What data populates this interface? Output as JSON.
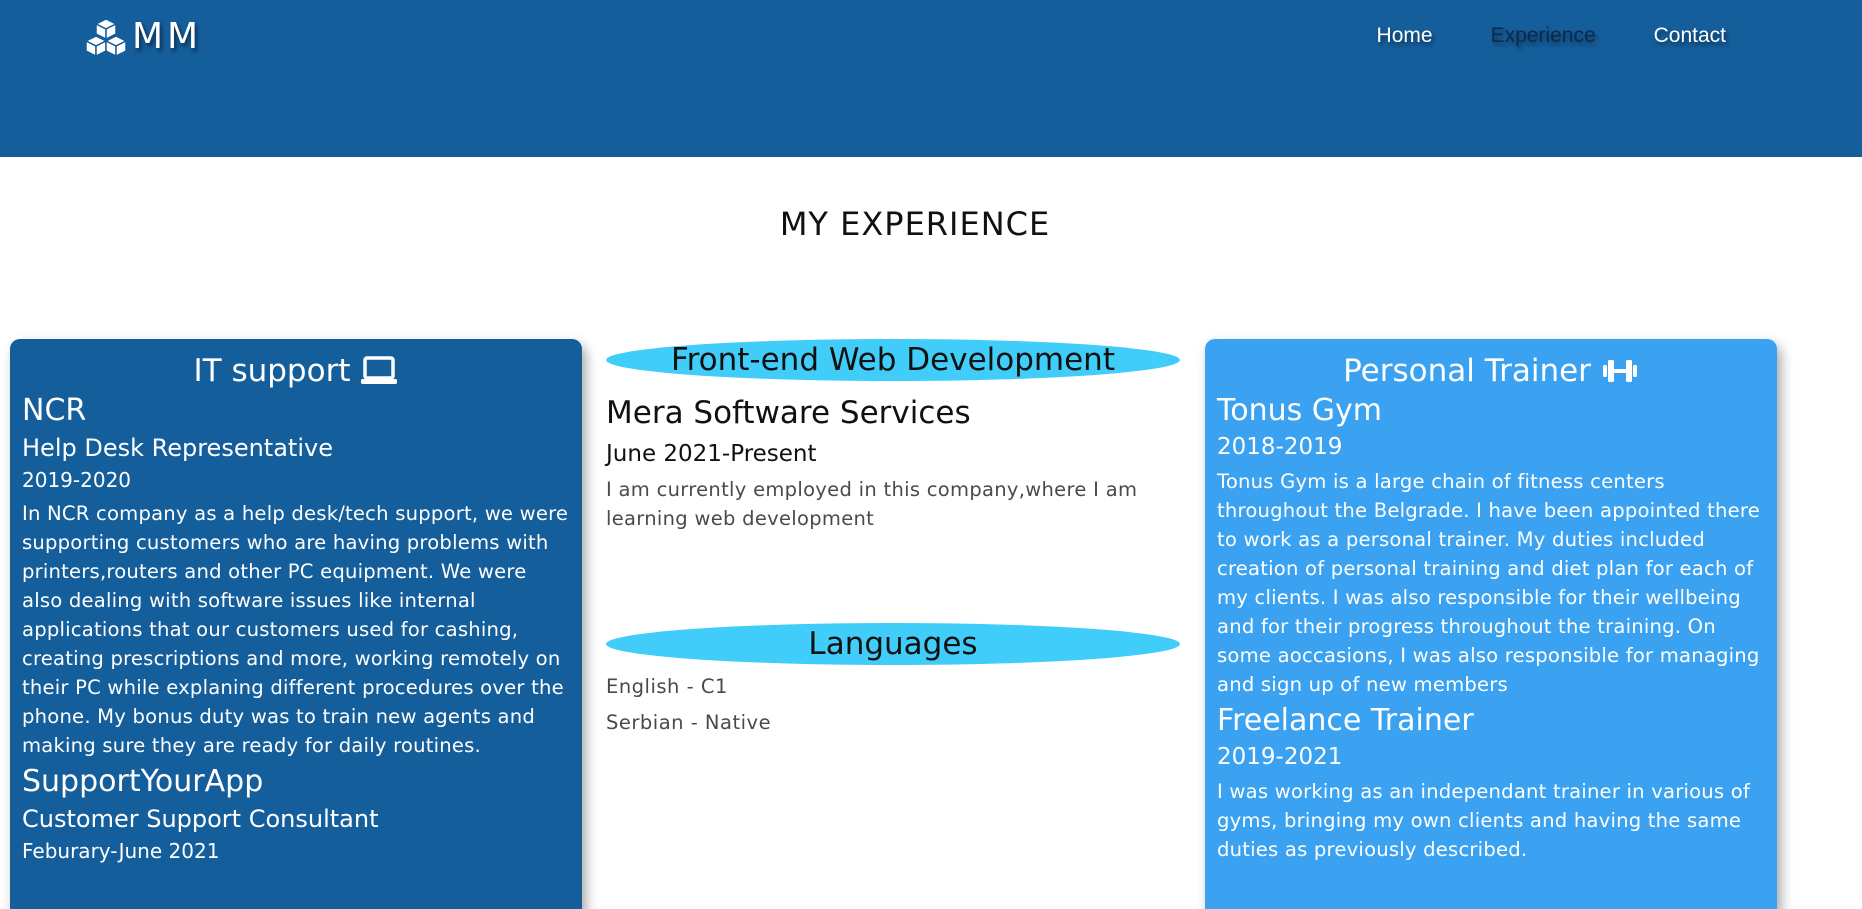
{
  "header": {
    "logo_text": "MM",
    "nav": [
      {
        "label": "Home"
      },
      {
        "label": "Experience"
      },
      {
        "label": "Contact"
      }
    ]
  },
  "page_title": "MY EXPERIENCE",
  "left_card": {
    "title": "IT support",
    "icon": "laptop-icon",
    "jobs": [
      {
        "company": "NCR",
        "role": "Help Desk Representative",
        "period": "2019-2020",
        "description": "In NCR company as a help desk/tech support, we were supporting customers who are having problems with printers,routers and other PC equipment. We were also dealing with software issues like internal applications that our customers used for cashing, creating prescriptions and more, working remotely on their PC while explaning different procedures over the phone. My bonus duty was to train new agents and making sure they are ready for daily routines."
      },
      {
        "company": "SupportYourApp",
        "role": "Customer Support Consultant",
        "period": "Feburary-June 2021"
      }
    ]
  },
  "middle": {
    "web_dev": {
      "title": "Front-end Web Development",
      "company": "Mera Software Services",
      "period": "June 2021-Present",
      "description": "I am currently employed in this company,where I am learning web development"
    },
    "languages": {
      "title": "Languages",
      "items": [
        "English - C1",
        "Serbian - Native"
      ]
    }
  },
  "right_card": {
    "title": "Personal Trainer",
    "icon": "dumbbell-icon",
    "jobs": [
      {
        "company": "Tonus Gym",
        "period": "2018-2019",
        "description": "Tonus Gym is a large chain of fitness centers throughout the Belgrade. I have been appointed there to work as a personal trainer. My duties included creation of personal training and diet plan for each of my clients. I was also responsible for their wellbeing and for their progress throughout the training. On some aoccasions, I was also responsible for managing and sign up of new members"
      },
      {
        "company": "Freelance Trainer",
        "period": "2019-2021",
        "description": "I was working as an independant trainer in various of gyms, bringing my own clients and having the same duties as previously described."
      }
    ]
  },
  "colors": {
    "header_bg": "#155e9c",
    "left_card_bg": "#155e9c",
    "right_card_bg": "#3aa2f1",
    "pill_bg": "#40cdf9"
  }
}
